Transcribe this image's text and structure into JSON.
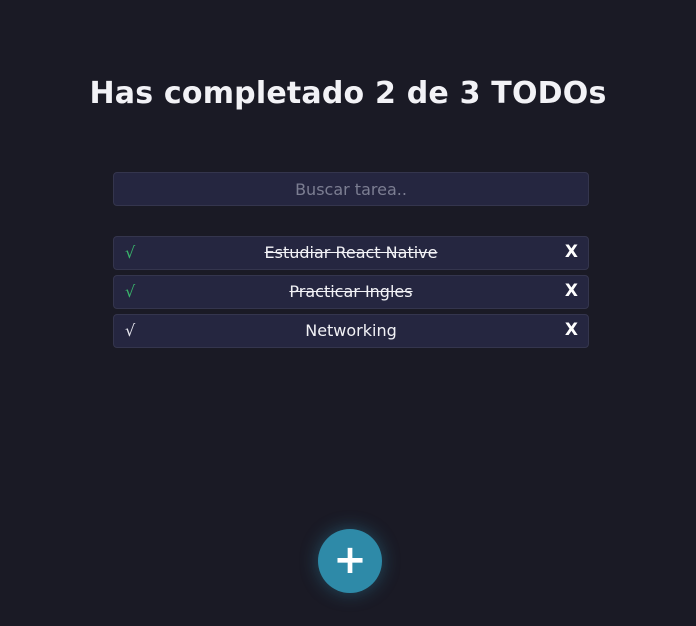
{
  "header": {
    "title": "Has completado 2 de 3 TODOs"
  },
  "search": {
    "placeholder": "Buscar tarea..",
    "value": ""
  },
  "todos": [
    {
      "check": "√",
      "text": "Estudiar React Native",
      "completed": true,
      "delete": "X"
    },
    {
      "check": "√",
      "text": "Practicar Ingles",
      "completed": true,
      "delete": "X"
    },
    {
      "check": "√",
      "text": "Networking",
      "completed": false,
      "delete": "X"
    }
  ],
  "fab": {
    "label": "+"
  },
  "colors": {
    "background": "#1a1a25",
    "item_background": "#252640",
    "accent": "#2e8aa8",
    "check_done": "#39b36b"
  }
}
